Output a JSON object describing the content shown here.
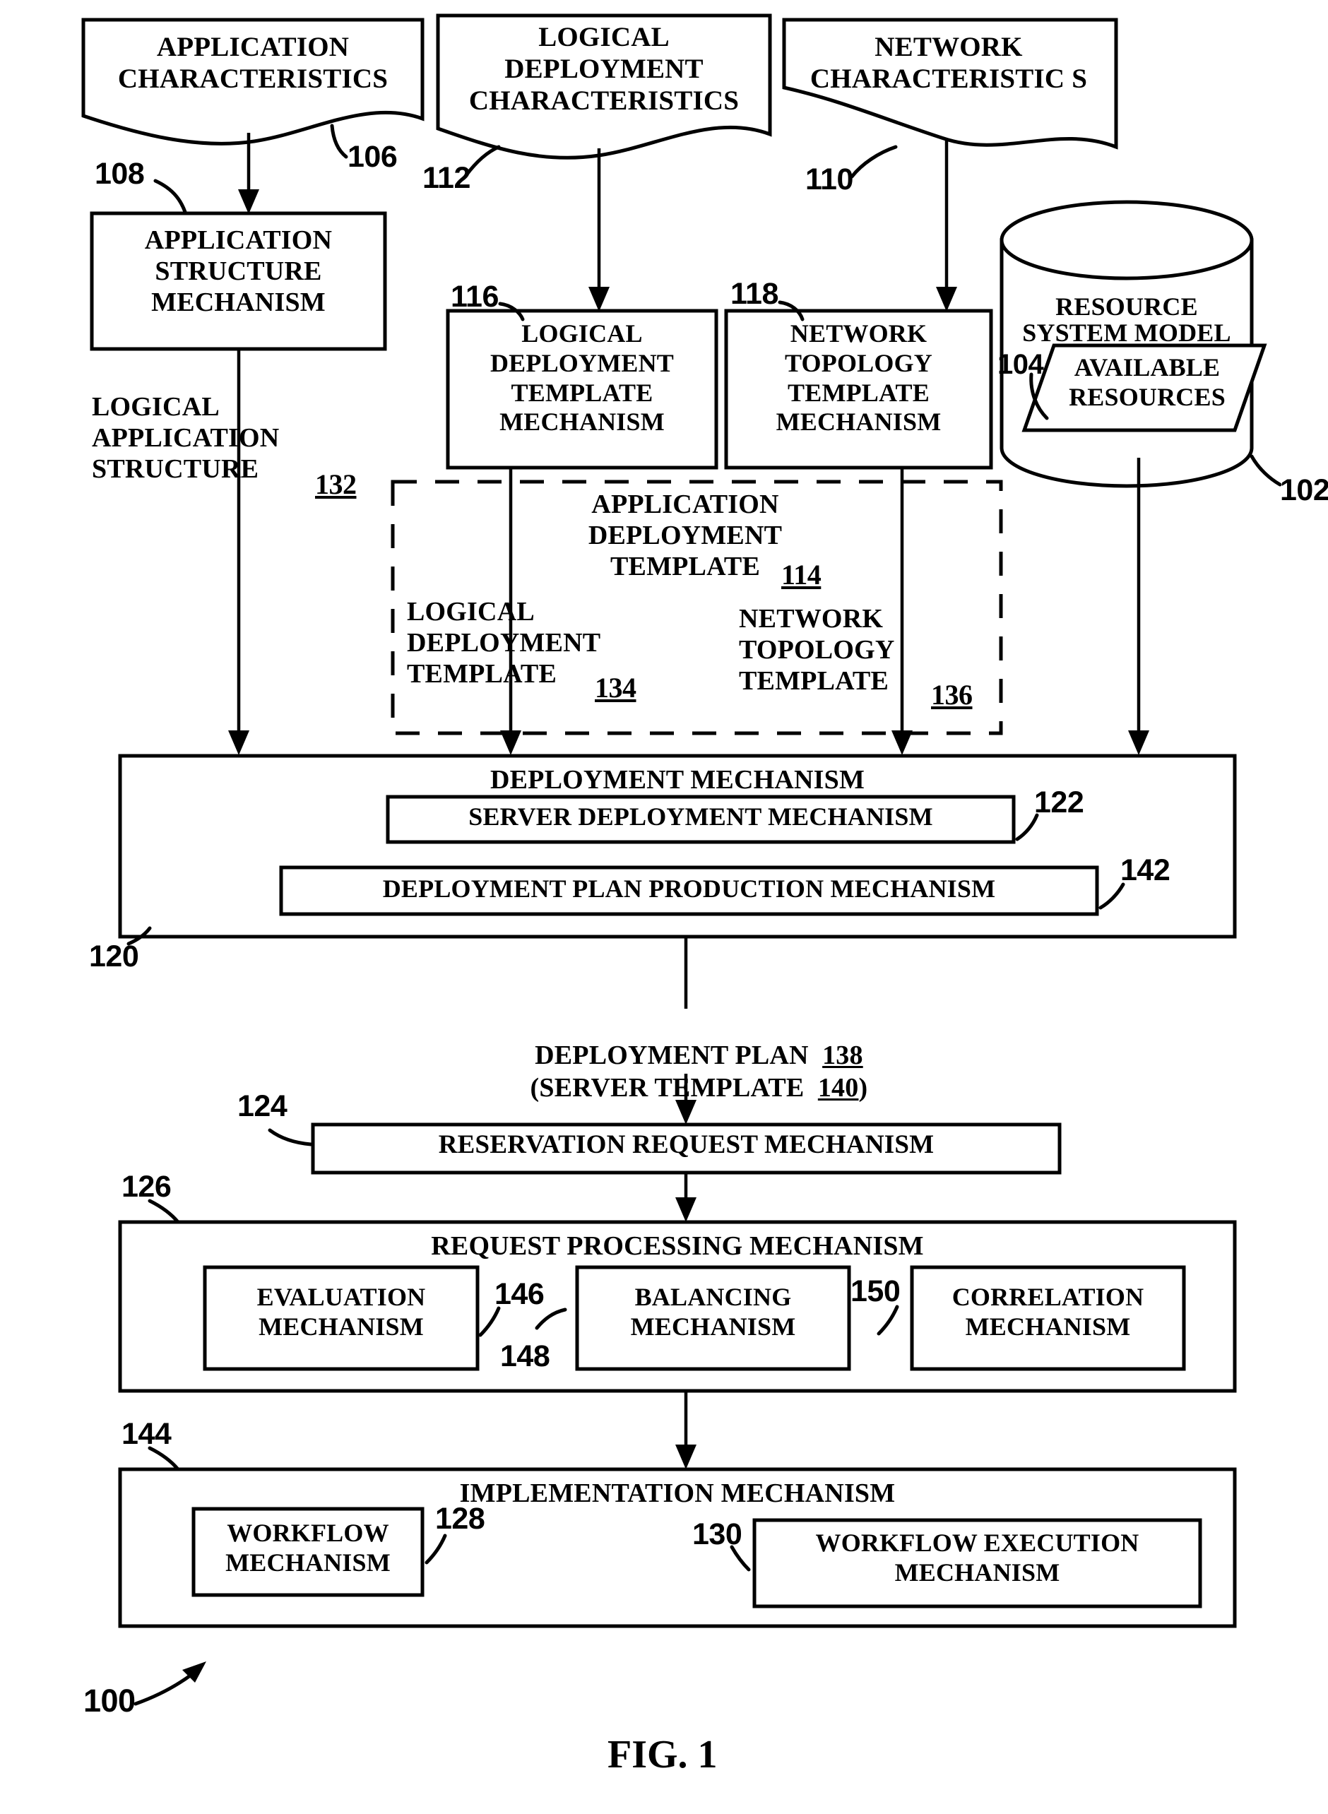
{
  "figure": {
    "caption": "FIG. 1",
    "system_ref": "100"
  },
  "inputs": [
    {
      "id": "application-characteristics",
      "label": "APPLICATION\nCHARACTERISTICS",
      "ref": "106"
    },
    {
      "id": "logical-deployment-characteristics",
      "label": "LOGICAL\nDEPLOYMENT\nCHARACTERISTICS",
      "ref": "112"
    },
    {
      "id": "network-characteristics",
      "label": "NETWORK\nCHARACTERISTIC S",
      "ref": "110"
    }
  ],
  "mechanisms": {
    "application_structure": {
      "label": "APPLICATION\nSTRUCTURE\nMECHANISM",
      "ref": "108"
    },
    "logical_deployment_template": {
      "label": "LOGICAL\nDEPLOYMENT\nTEMPLATE\nMECHANISM",
      "ref": "116"
    },
    "network_topology_template": {
      "label": "NETWORK\nTOPOLOGY\nTEMPLATE\nMECHANISM",
      "ref": "118"
    },
    "deployment": {
      "label": "DEPLOYMENT MECHANISM",
      "ref": "120",
      "children": [
        {
          "label": "SERVER DEPLOYMENT MECHANISM",
          "ref": "122"
        },
        {
          "label": "DEPLOYMENT PLAN PRODUCTION MECHANISM",
          "ref": "142"
        }
      ]
    },
    "reservation_request": {
      "label": "RESERVATION REQUEST MECHANISM",
      "ref": "124"
    },
    "request_processing": {
      "label": "REQUEST PROCESSING MECHANISM",
      "ref": "126",
      "children": [
        {
          "label": "EVALUATION\nMECHANISM",
          "ref": "146"
        },
        {
          "label": "BALANCING\nMECHANISM",
          "ref": "148"
        },
        {
          "label": "CORRELATION\nMECHANISM",
          "ref": "150"
        }
      ]
    },
    "implementation": {
      "label": "IMPLEMENTATION MECHANISM",
      "ref": "144",
      "children": [
        {
          "label": "WORKFLOW\nMECHANISM",
          "ref": "128"
        },
        {
          "label": "WORKFLOW EXECUTION\nMECHANISM",
          "ref": "130"
        }
      ]
    }
  },
  "datastore": {
    "label": "RESOURCE\nSYSTEM MODEL",
    "ref": "102",
    "inner": {
      "label": "AVAILABLE\nRESOURCES",
      "ref": "104"
    }
  },
  "artifacts": {
    "logical_application_structure": {
      "label": "LOGICAL\nAPPLICATION\nSTRUCTURE",
      "ref": "132"
    },
    "application_deployment_template": {
      "label": "APPLICATION\nDEPLOYMENT\nTEMPLATE",
      "ref": "114"
    },
    "logical_deployment_template": {
      "label": "LOGICAL\nDEPLOYMENT\nTEMPLATE",
      "ref": "134"
    },
    "network_topology_template": {
      "label": "NETWORK\nTOPOLOGY\nTEMPLATE",
      "ref": "136"
    },
    "deployment_plan": {
      "label": "DEPLOYMENT PLAN",
      "ref": "138",
      "sub_label": "(SERVER TEMPLATE",
      "sub_ref": "140",
      "sub_close": ")"
    }
  }
}
